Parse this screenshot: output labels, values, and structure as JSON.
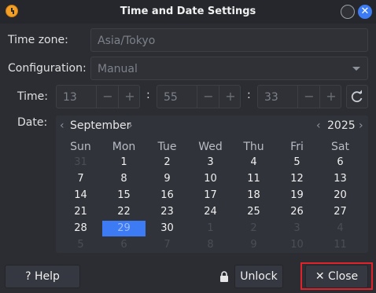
{
  "window": {
    "title": "Time and Date Settings",
    "close_glyph": "✕"
  },
  "timezone": {
    "label": "Time zone:",
    "value": "Asia/Tokyo"
  },
  "configuration": {
    "label": "Configuration:",
    "value": "Manual"
  },
  "time": {
    "label": "Time:",
    "hour": "13",
    "minute": "55",
    "second": "33",
    "minus": "−",
    "plus": "+",
    "separator": ":"
  },
  "date": {
    "label": "Date:",
    "month": "September",
    "year": "2025",
    "prev": "‹",
    "next": "›",
    "weekdays": [
      "Sun",
      "Mon",
      "Tue",
      "Wed",
      "Thu",
      "Fri",
      "Sat"
    ],
    "days": [
      [
        "31",
        "1",
        "2",
        "3",
        "4",
        "5",
        "6"
      ],
      [
        "7",
        "8",
        "9",
        "10",
        "11",
        "12",
        "13"
      ],
      [
        "14",
        "15",
        "16",
        "17",
        "18",
        "19",
        "20"
      ],
      [
        "21",
        "22",
        "23",
        "24",
        "25",
        "26",
        "27"
      ],
      [
        "28",
        "29",
        "30",
        "1",
        "2",
        "3",
        "4"
      ],
      [
        "5",
        "6",
        "7",
        "8",
        "9",
        "10",
        "11"
      ]
    ],
    "selected_day": "29"
  },
  "buttons": {
    "help": "? Help",
    "unlock": "Unlock",
    "close": "✕ Close"
  },
  "colors": {
    "accent": "#3d7bf5",
    "highlight": "#e0232b",
    "background": "#2b2d33"
  }
}
